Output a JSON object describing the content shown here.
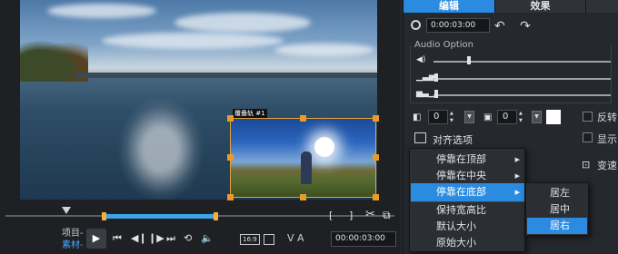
{
  "preview": {
    "overlay_clip_label": "覆叠轨 #1",
    "mode_labels": [
      "项目-",
      "素材-"
    ],
    "active_mode": "素材-",
    "timecode": "00:00:03:00",
    "aspect_ratio": "16:9",
    "text_tool_label": "V A",
    "icons": {
      "mark_in": "mark-in-icon",
      "mark_out": "mark-out-icon",
      "cut": "scissors-icon",
      "snapshot": "snapshot-icon",
      "play": "play-icon",
      "home": "home-icon",
      "prev_frame": "prev-frame-icon",
      "next_frame": "next-frame-icon",
      "end": "end-icon",
      "repeat": "repeat-icon",
      "volume": "volume-icon"
    }
  },
  "options": {
    "tabs": [
      "编辑",
      "效果"
    ],
    "active_tab": "编辑",
    "duration": "0:00:03:00",
    "audio_option_title": "Audio Option",
    "border_size": "0",
    "shadow_size": "0",
    "border_color": "#ffffff",
    "checkbox_labels": [
      "反转",
      "显示",
      "变速"
    ],
    "align_options_label": "对齐选项"
  },
  "align_menu": {
    "items": [
      "停靠在顶部",
      "停靠在中央",
      "停靠在底部",
      "保持宽高比",
      "默认大小",
      "原始大小"
    ],
    "selected": "停靠在底部",
    "submenu": {
      "items": [
        "居左",
        "居中",
        "居右"
      ],
      "selected": "居右"
    }
  },
  "colors": {
    "accent": "#2a8be0",
    "handle": "#e89b27",
    "panel_bg": "#25282c"
  }
}
